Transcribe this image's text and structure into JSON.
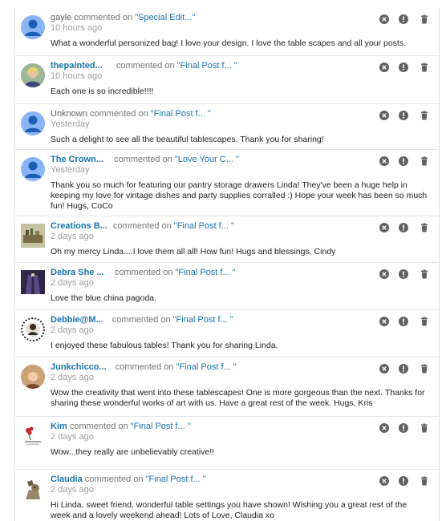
{
  "verb": "commented on",
  "icons": {
    "remove": "remove-circle-icon",
    "spam": "report-spam-icon",
    "delete": "trash-icon"
  },
  "colors": {
    "link": "#1a73a8",
    "icon": "#616161",
    "default_avatar": "#8ab4f8"
  },
  "comments": [
    {
      "author": "gayle",
      "post": "\"Special Edit...\"",
      "time": "10 hours ago",
      "text": "What a wonderful personized bag! I love your design. I love the table scapes and all your posts."
    },
    {
      "author": "thepainted...",
      "post": "\"Final Post f... \"",
      "time": "10 hours ago",
      "text": "Each one is so incredible!!!!"
    },
    {
      "author": "Unknown",
      "post": "\"Final Post f... \"",
      "time": "Yesterday",
      "text": "Such a delight to see all the beautiful tablescapes. Thank you for sharing!"
    },
    {
      "author": "The Crown...",
      "post": "\"Love Your C... \"",
      "time": "Yesterday",
      "text": "Thank you so much for featuring our pantry storage drawers Linda! They've been a huge help in keeping my love for vintage dishes and party supplies corralled :) Hope your week has been so much fun! Hugs, CoCo"
    },
    {
      "author": "Creations B...",
      "post": "\"Final Post f... \"",
      "time": "2 days ago",
      "text": "Oh my mercy Linda....I love them all all! How fun! Hugs and blessings, Cindy"
    },
    {
      "author": "Debra She ...",
      "post": "\"Final Post f... \"",
      "time": "2 days ago",
      "text": "Love the blue china pagoda."
    },
    {
      "author": "Debbie@M...",
      "post": "\"Final Post f... \"",
      "time": "2 days ago",
      "text": "I enjoyed these fabulous tables! Thank you for sharing Linda."
    },
    {
      "author": "Junkchicco...",
      "post": "\"Final Post f... \"",
      "time": "2 days ago",
      "text": "Wow the creativity that went into these tablescapes! One is more gorgeous than the next. Thanks for sharing these wonderful works of art with us. Have a great rest of the week. Hugs, Kris"
    },
    {
      "author": "Kim",
      "post": "\"Final Post f... \"",
      "time": "2 days ago",
      "text": "Wow...they really are unbelievably creative!!"
    },
    {
      "author": "Claudia",
      "post": "\"Final Post f... \"",
      "time": "2 days ago",
      "text": "Hi Linda, sweet friend, wonderful table settings you have shown! Wishing you a great rest of the week and a lovely weekend ahead! Lots of Love, Claudia xo"
    }
  ]
}
